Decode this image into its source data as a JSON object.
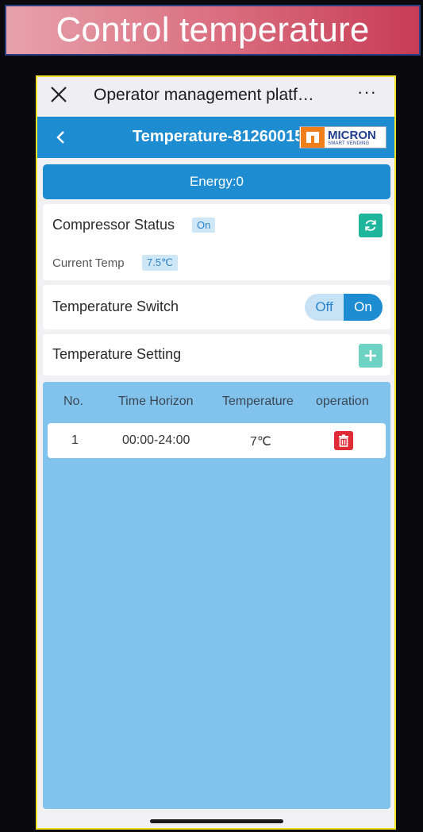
{
  "banner": {
    "title": "Control temperature"
  },
  "window": {
    "title": "Operator management platf…",
    "more": "···"
  },
  "nav": {
    "title": "Temperature-81260015",
    "logo": {
      "brand": "MICRON",
      "tagline": "SMART VENDING"
    }
  },
  "energy": {
    "label": "Energy:0"
  },
  "compressor": {
    "label": "Compressor Status",
    "status": "On",
    "current_temp_label": "Current Temp",
    "current_temp_value": "7.5℃"
  },
  "temp_switch": {
    "label": "Temperature Switch",
    "off_label": "Off",
    "on_label": "On",
    "state": "On"
  },
  "temp_setting": {
    "label": "Temperature Setting"
  },
  "table": {
    "headers": [
      "No.",
      "Time Horizon",
      "Temperature",
      "operation"
    ],
    "rows": [
      {
        "no": "1",
        "time": "00:00-24:00",
        "temperature": "7℃"
      }
    ]
  },
  "colors": {
    "primary": "#1e8cd1",
    "refresh": "#1fb59c",
    "add": "#6fd3c4",
    "delete": "#e02a36",
    "table_bg": "#82c3ee",
    "phone_border": "#f1e226"
  }
}
